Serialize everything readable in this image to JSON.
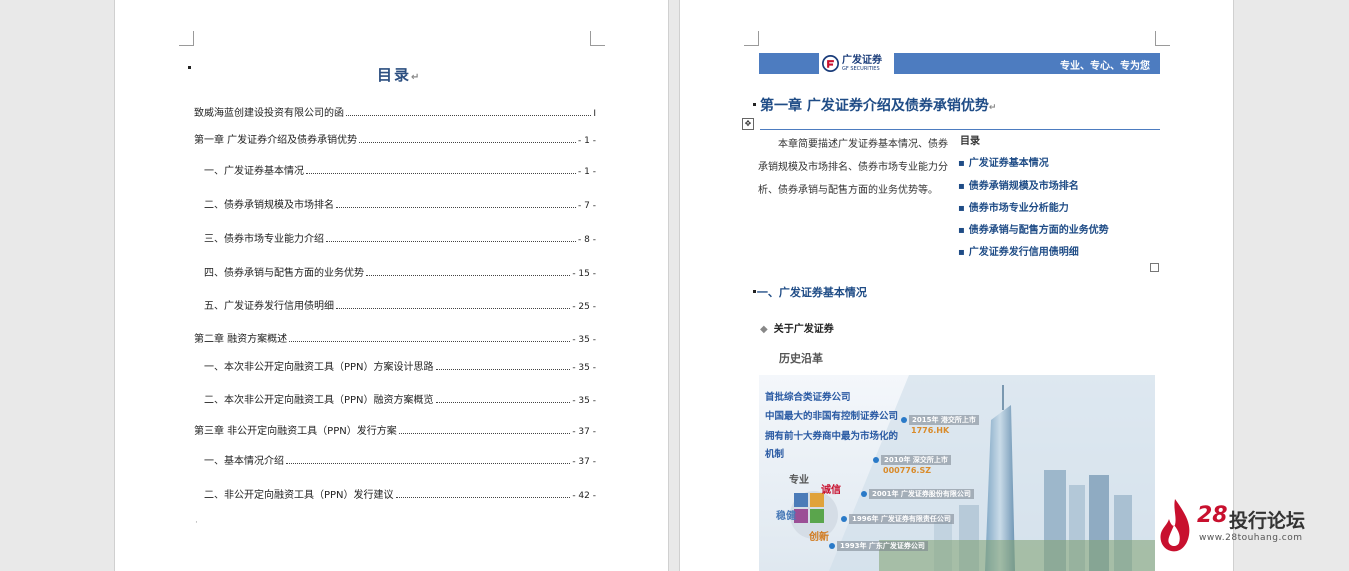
{
  "left_page": {
    "toc_title": "目录",
    "toc_entries": [
      {
        "text": "致威海蓝创建设投资有限公司的函",
        "page": "I"
      },
      {
        "text": "第一章  广发证券介绍及债券承销优势",
        "page": "- 1 -"
      },
      {
        "text": "一、广发证券基本情况",
        "page": "- 1 -"
      },
      {
        "text": "二、债券承销规模及市场排名",
        "page": "- 7 -"
      },
      {
        "text": "三、债券市场专业能力介绍",
        "page": "- 8 -"
      },
      {
        "text": "四、债券承销与配售方面的业务优势",
        "page": "- 15 -"
      },
      {
        "text": "五、广发证券发行信用债明细",
        "page": "- 25 -"
      },
      {
        "text": "第二章    融资方案概述",
        "page": "- 35 -"
      },
      {
        "text": "一、本次非公开定向融资工具（PPN）方案设计思路",
        "page": "- 35 -"
      },
      {
        "text": "二、本次非公开定向融资工具（PPN）融资方案概览",
        "page": "- 35 -"
      },
      {
        "text": "第三章    非公开定向融资工具（PPN）发行方案",
        "page": "- 37 -"
      },
      {
        "text": "一、基本情况介绍",
        "page": "- 37 -"
      },
      {
        "text": "二、非公开定向融资工具（PPN）发行建议",
        "page": "- 42 -"
      }
    ]
  },
  "right_page": {
    "banner": {
      "logo_cn": "广发证券",
      "logo_en": "GF SECURITIES",
      "slogan": "专业、专心、专为您",
      "color": "#4d7cc0"
    },
    "chapter_title": "第一章  广发证券介绍及债券承销优势",
    "intro_text": "本章简要描述广发证券基本情况、债券承销规模及市场排名、债券市场专业能力分析、债券承销与配售方面的业务优势等。",
    "mini_toc_title": "目录",
    "mini_toc_items": [
      "广发证券基本情况",
      "债券承销规模及市场排名",
      "债券市场专业分析能力",
      "债券承销与配售方面的业务优势",
      "广发证券发行信用债明细"
    ],
    "section_title": "一、广发证券基本情况",
    "subsection_title": "关于广发证券",
    "history_label": "历史沿革",
    "hero": {
      "headlines": [
        "首批综合类证券公司",
        "中国最大的非国有控制证券公司",
        "拥有前十大券商中最为市场化的",
        "机制"
      ],
      "timeline": [
        {
          "label": "2015年 港交所上市",
          "code": "1776.HK"
        },
        {
          "label": "2010年 深交所上市",
          "code": "000776.SZ"
        },
        {
          "label": "2001年 广发证券股份有限公司",
          "code": ""
        },
        {
          "label": "1996年 广发证券有限责任公司",
          "code": ""
        },
        {
          "label": "1993年 广东广发证券公司",
          "code": ""
        }
      ],
      "values": [
        "专业",
        "诚信",
        "稳健",
        "创新"
      ]
    }
  },
  "watermark": {
    "number": "28",
    "name": "投行论坛",
    "url": "www.28touhang.com"
  }
}
